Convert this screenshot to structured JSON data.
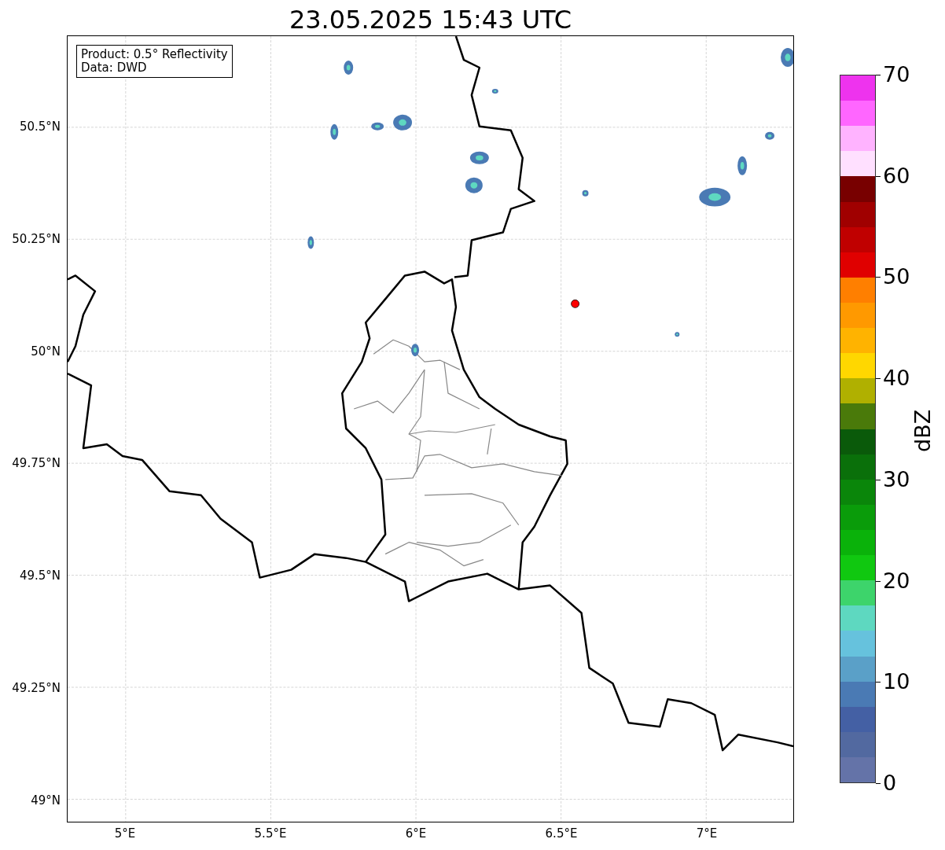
{
  "title": "23.05.2025 15:43 UTC",
  "info_box": {
    "lines": [
      "Product: 0.5° Reflectivity",
      "Data: DWD"
    ]
  },
  "map": {
    "lat_labels": [
      "50.5°N",
      "50.25°N",
      "50°N",
      "49.75°N",
      "49.5°N",
      "49.25°N",
      "49°N"
    ],
    "lon_labels": [
      "5°E",
      "5.5°E",
      "6°E",
      "6.5°E",
      "7°E"
    ]
  },
  "colorbar": {
    "label": "dBZ",
    "ticks": [
      "70",
      "60",
      "50",
      "40",
      "30",
      "20",
      "10",
      "0"
    ],
    "bands": [
      {
        "color": "#ee33ee"
      },
      {
        "color": "#ff66ff"
      },
      {
        "color": "#ffb3ff"
      },
      {
        "color": "#ffe0ff"
      },
      {
        "color": "#780000"
      },
      {
        "color": "#a00000"
      },
      {
        "color": "#c00000"
      },
      {
        "color": "#e00000"
      },
      {
        "color": "#ff7f00"
      },
      {
        "color": "#ff9900"
      },
      {
        "color": "#ffb300"
      },
      {
        "color": "#ffd700"
      },
      {
        "color": "#b0b000"
      },
      {
        "color": "#4a7a0a"
      },
      {
        "color": "#0a5a0a"
      },
      {
        "color": "#0a700a"
      },
      {
        "color": "#0a860a"
      },
      {
        "color": "#0a9c0a"
      },
      {
        "color": "#0ab20a"
      },
      {
        "color": "#10c810"
      },
      {
        "color": "#3dd46b"
      },
      {
        "color": "#5ed8c0"
      },
      {
        "color": "#66c2dd"
      },
      {
        "color": "#5aa0c8"
      },
      {
        "color": "#4a7ab4"
      },
      {
        "color": "#4460a4"
      },
      {
        "color": "#5269a0"
      },
      {
        "color": "#6473a8"
      }
    ]
  }
}
